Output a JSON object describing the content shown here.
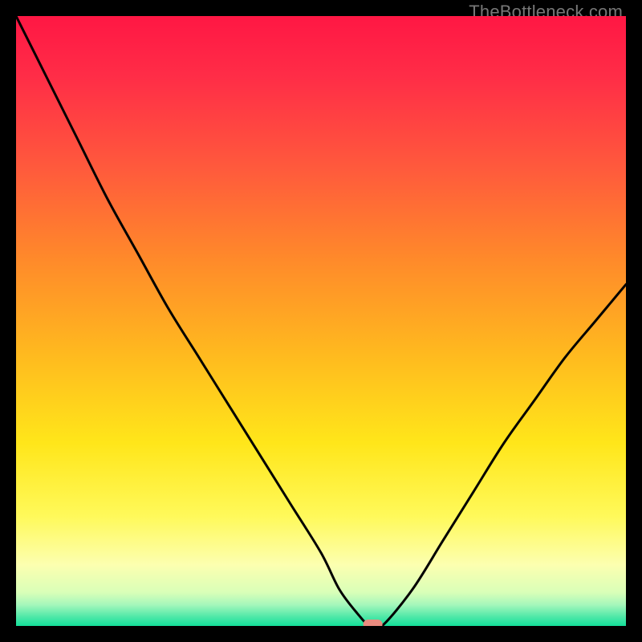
{
  "watermark": "TheBottleneck.com",
  "chart_data": {
    "type": "line",
    "title": "",
    "xlabel": "",
    "ylabel": "",
    "xlim": [
      0,
      100
    ],
    "ylim": [
      0,
      100
    ],
    "grid": false,
    "legend": false,
    "series": [
      {
        "name": "bottleneck-curve",
        "x": [
          0,
          5,
          10,
          15,
          20,
          25,
          30,
          35,
          40,
          45,
          50,
          53,
          56,
          58,
          60,
          65,
          70,
          75,
          80,
          85,
          90,
          95,
          100
        ],
        "values": [
          100,
          90,
          80,
          70,
          61,
          52,
          44,
          36,
          28,
          20,
          12,
          6,
          2,
          0,
          0,
          6,
          14,
          22,
          30,
          37,
          44,
          50,
          56
        ]
      }
    ],
    "marker": {
      "x": 58.5,
      "y": 0,
      "color": "#e98b7f"
    },
    "gradient_stops": [
      {
        "offset": 0.0,
        "color": "#ff1744"
      },
      {
        "offset": 0.1,
        "color": "#ff2d47"
      },
      {
        "offset": 0.25,
        "color": "#ff5a3c"
      },
      {
        "offset": 0.4,
        "color": "#ff8a2a"
      },
      {
        "offset": 0.55,
        "color": "#ffb81f"
      },
      {
        "offset": 0.7,
        "color": "#ffe61a"
      },
      {
        "offset": 0.82,
        "color": "#fff95a"
      },
      {
        "offset": 0.9,
        "color": "#fcffb0"
      },
      {
        "offset": 0.945,
        "color": "#d9ffb8"
      },
      {
        "offset": 0.965,
        "color": "#a6f7bb"
      },
      {
        "offset": 0.985,
        "color": "#4fe8a8"
      },
      {
        "offset": 1.0,
        "color": "#13df99"
      }
    ]
  }
}
